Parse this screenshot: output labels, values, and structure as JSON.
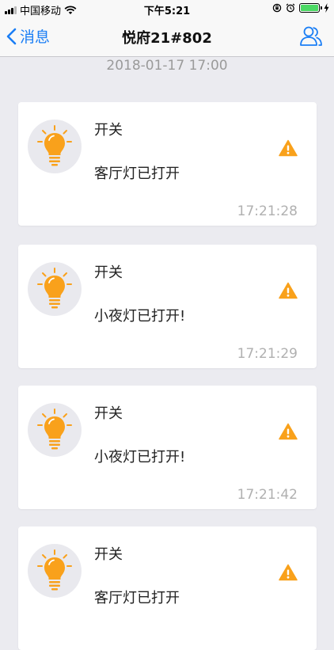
{
  "status_bar": {
    "carrier": "中国移动",
    "time": "下午5:21"
  },
  "nav": {
    "back_label": "消息",
    "title": "悦府21#802"
  },
  "date_label": "2018-01-17 17:00",
  "messages": [
    {
      "title": "开关",
      "text": "客厅灯已打开",
      "time": "17:21:28"
    },
    {
      "title": "开关",
      "text": "小夜灯已打开!",
      "time": "17:21:29"
    },
    {
      "title": "开关",
      "text": "小夜灯已打开!",
      "time": "17:21:42"
    },
    {
      "title": "开关",
      "text": "客厅灯已打开",
      "time": ""
    }
  ],
  "icons": {
    "bulb": "lightbulb-icon",
    "warning": "warning-icon",
    "back": "chevron-left-icon",
    "contacts": "people-icon"
  },
  "colors": {
    "accent": "#1a7ef5",
    "bulb": "#f9a11b",
    "battery": "#4cd964"
  },
  "battery_level": 1.0
}
